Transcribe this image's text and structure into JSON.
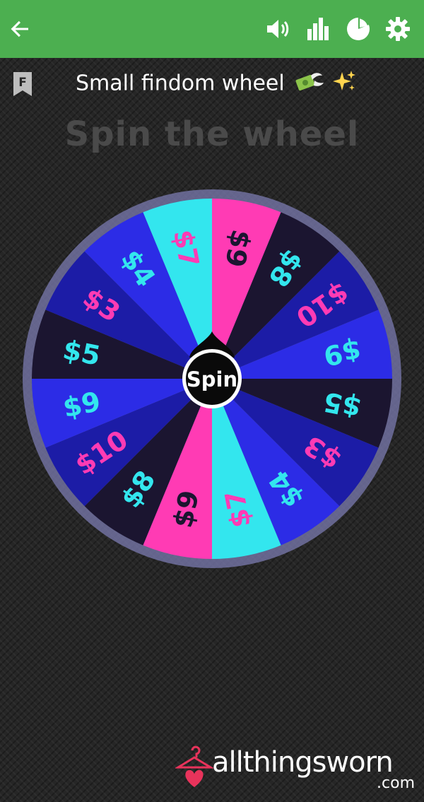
{
  "topbar": {
    "color": "#4caf50",
    "icons": [
      "back-arrow-icon",
      "volume-icon",
      "bar-chart-icon",
      "pie-chart-icon",
      "gear-icon"
    ]
  },
  "wheel": {
    "title": "Small findom wheel",
    "title_emoji": [
      "money-with-wings-emoji",
      "sparkles-emoji"
    ],
    "heading": "Spin the wheel",
    "spin_label": "Spin",
    "segments": [
      {
        "label": "$9",
        "bg": "#ff3bb4",
        "fg": "#1b1530"
      },
      {
        "label": "$8",
        "bg": "#1b1530",
        "fg": "#33e6ee"
      },
      {
        "label": "$10",
        "bg": "#1c1ca6",
        "fg": "#ff3bb4"
      },
      {
        "label": "$9",
        "bg": "#2c2ce6",
        "fg": "#33e6ee"
      },
      {
        "label": "$5",
        "bg": "#1b1530",
        "fg": "#33e6ee"
      },
      {
        "label": "$3",
        "bg": "#1c1ca6",
        "fg": "#ff3bb4"
      },
      {
        "label": "$4",
        "bg": "#2c2ce6",
        "fg": "#33e6ee"
      },
      {
        "label": "$7",
        "bg": "#33e6ee",
        "fg": "#ff3bb4"
      },
      {
        "label": "$9",
        "bg": "#ff3bb4",
        "fg": "#1b1530"
      },
      {
        "label": "$8",
        "bg": "#1b1530",
        "fg": "#33e6ee"
      },
      {
        "label": "$10",
        "bg": "#1c1ca6",
        "fg": "#ff3bb4"
      },
      {
        "label": "$9",
        "bg": "#2c2ce6",
        "fg": "#33e6ee"
      },
      {
        "label": "$5",
        "bg": "#1b1530",
        "fg": "#33e6ee"
      },
      {
        "label": "$3",
        "bg": "#1c1ca6",
        "fg": "#ff3bb4"
      },
      {
        "label": "$4",
        "bg": "#2c2ce6",
        "fg": "#33e6ee"
      },
      {
        "label": "$7",
        "bg": "#33e6ee",
        "fg": "#ff3bb4"
      }
    ]
  },
  "watermark": {
    "text": "allthingsworn",
    "domain": ".com",
    "accent": "#e8335b"
  }
}
